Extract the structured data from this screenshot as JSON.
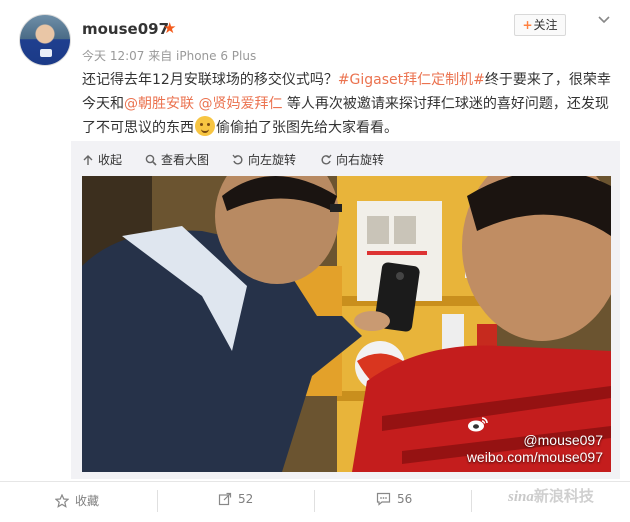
{
  "user": {
    "name": "mouse097",
    "meta": "今天 12:07 来自 iPhone 6 Plus"
  },
  "follow_label": "关注",
  "post": {
    "t1": "还记得去年12月安联球场的移交仪式吗？",
    "hashtag": "#Gigaset拜仁定制机#",
    "t2": "终于要来了，很荣幸今天和",
    "mention1": "@朝胜安联",
    "mention2": "@贤妈爱拜仁",
    "t3": " 等人再次被邀请来探讨拜仁球迷的喜好问题，还发现了不可思议的东西",
    "t4": "偷偷拍了张图先给大家看看。"
  },
  "toolbar": {
    "collapse": "收起",
    "view_large": "查看大图",
    "rotate_left": "向左旋转",
    "rotate_right": "向右旋转"
  },
  "watermark": {
    "handle": "@mouse097",
    "url": "weibo.com/mouse097"
  },
  "actions": {
    "favorite": "收藏",
    "repost_count": "52",
    "comment_count": "56"
  },
  "brand": {
    "latin": "sina",
    "cn": "新浪科技"
  },
  "colors": {
    "link": "#eb7350",
    "star": "#f35b1c",
    "muted": "#999999"
  }
}
